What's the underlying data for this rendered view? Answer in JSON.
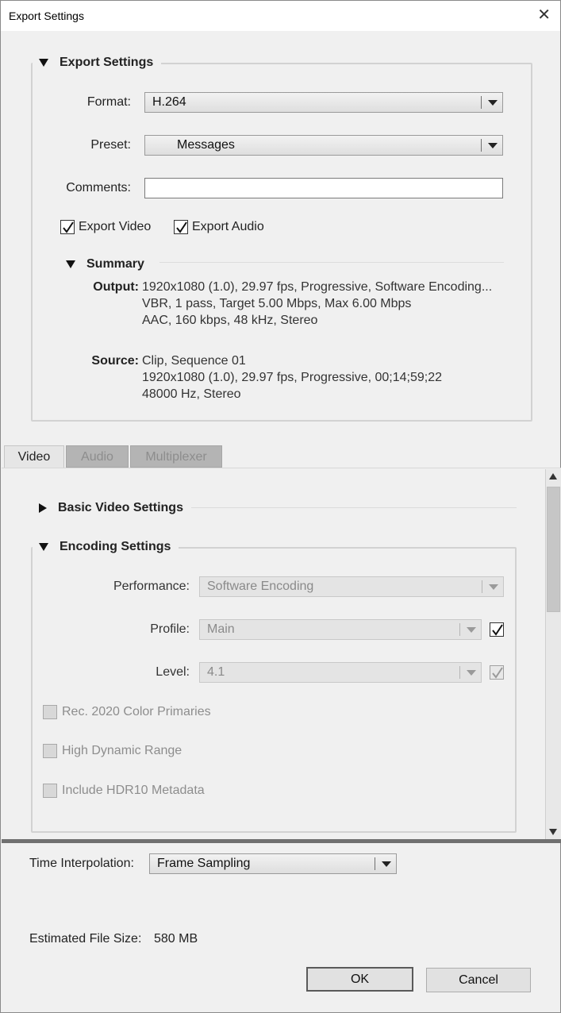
{
  "window": {
    "title": "Export Settings"
  },
  "export_settings": {
    "section_title": "Export Settings",
    "format_label": "Format:",
    "format_value": "H.264",
    "preset_label": "Preset:",
    "preset_value": "Messages",
    "comments_label": "Comments:",
    "comments_value": "",
    "export_video_label": "Export Video",
    "export_video_checked": true,
    "export_audio_label": "Export Audio",
    "export_audio_checked": true
  },
  "summary": {
    "title": "Summary",
    "output_key": "Output:",
    "output_lines": [
      "1920x1080 (1.0), 29.97 fps, Progressive, Software Encoding...",
      "VBR, 1 pass, Target 5.00 Mbps, Max 6.00 Mbps",
      "AAC, 160 kbps, 48 kHz, Stereo"
    ],
    "source_key": "Source:",
    "source_lines": [
      "Clip, Sequence 01",
      "1920x1080 (1.0), 29.97 fps, Progressive, 00;14;59;22",
      "48000 Hz, Stereo"
    ]
  },
  "tabs": [
    {
      "label": "Video",
      "active": true
    },
    {
      "label": "Audio",
      "active": false
    },
    {
      "label": "Multiplexer",
      "active": false
    }
  ],
  "basic_video": {
    "title": "Basic Video Settings"
  },
  "encoding": {
    "title": "Encoding Settings",
    "performance_label": "Performance:",
    "performance_value": "Software Encoding",
    "profile_label": "Profile:",
    "profile_value": "Main",
    "profile_checked": true,
    "level_label": "Level:",
    "level_value": "4.1",
    "level_checked": true,
    "rec2020_label": "Rec. 2020 Color Primaries",
    "hdr_label": "High Dynamic Range",
    "hdr10_label": "Include HDR10 Metadata"
  },
  "footer": {
    "time_interp_label": "Time Interpolation:",
    "time_interp_value": "Frame Sampling",
    "file_size_label": "Estimated File Size:",
    "file_size_value": "580 MB",
    "ok_label": "OK",
    "cancel_label": "Cancel"
  }
}
